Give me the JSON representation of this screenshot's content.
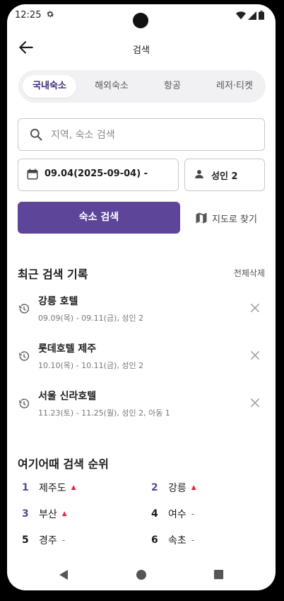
{
  "status": {
    "time": "12:25"
  },
  "header": {
    "title": "검색"
  },
  "tabs": [
    {
      "label": "국내숙소",
      "active": true
    },
    {
      "label": "해외숙소",
      "active": false
    },
    {
      "label": "항공",
      "active": false
    },
    {
      "label": "레저·티켓",
      "active": false
    }
  ],
  "search": {
    "placeholder": "지역, 숙소 검색",
    "value": ""
  },
  "date": {
    "label": "09.04(2025-09-04) -"
  },
  "guests": {
    "label": "성인 2"
  },
  "actions": {
    "search_button": "숙소 검색",
    "map_button": "지도로 찾기"
  },
  "recent": {
    "title": "최근 검색 기록",
    "clear_all": "전체삭제",
    "items": [
      {
        "name": "강릉 호텔",
        "detail": "09.09(목) - 09.11(금), 성인 2"
      },
      {
        "name": "롯데호텔 제주",
        "detail": "10.10(목) - 10.11(금), 성인 2"
      },
      {
        "name": "서울 신라호텔",
        "detail": "11.23(토) - 11.25(월), 성인 2, 아동 1"
      }
    ]
  },
  "ranking": {
    "title": "여기어때 검색 순위",
    "items": [
      {
        "rank": "1",
        "keyword": "제주도",
        "trend": "▲"
      },
      {
        "rank": "2",
        "keyword": "강릉",
        "trend": "▲"
      },
      {
        "rank": "3",
        "keyword": "부산",
        "trend": "▲"
      },
      {
        "rank": "4",
        "keyword": "여수",
        "trend": "-"
      },
      {
        "rank": "5",
        "keyword": "경주",
        "trend": "-"
      },
      {
        "rank": "6",
        "keyword": "속초",
        "trend": "-"
      }
    ]
  },
  "colors": {
    "accent": "#5d4699",
    "trend_up": "#e2283f",
    "tab_bg": "#f1f1f3"
  },
  "icons": {
    "status": [
      "gear-icon",
      "wifi-icon",
      "signal-icon",
      "battery-icon"
    ],
    "back": "arrow-left-icon",
    "search": "search-icon",
    "calendar": "calendar-icon",
    "person": "person-icon",
    "map": "map-icon",
    "history": "history-icon",
    "close": "close-icon"
  }
}
